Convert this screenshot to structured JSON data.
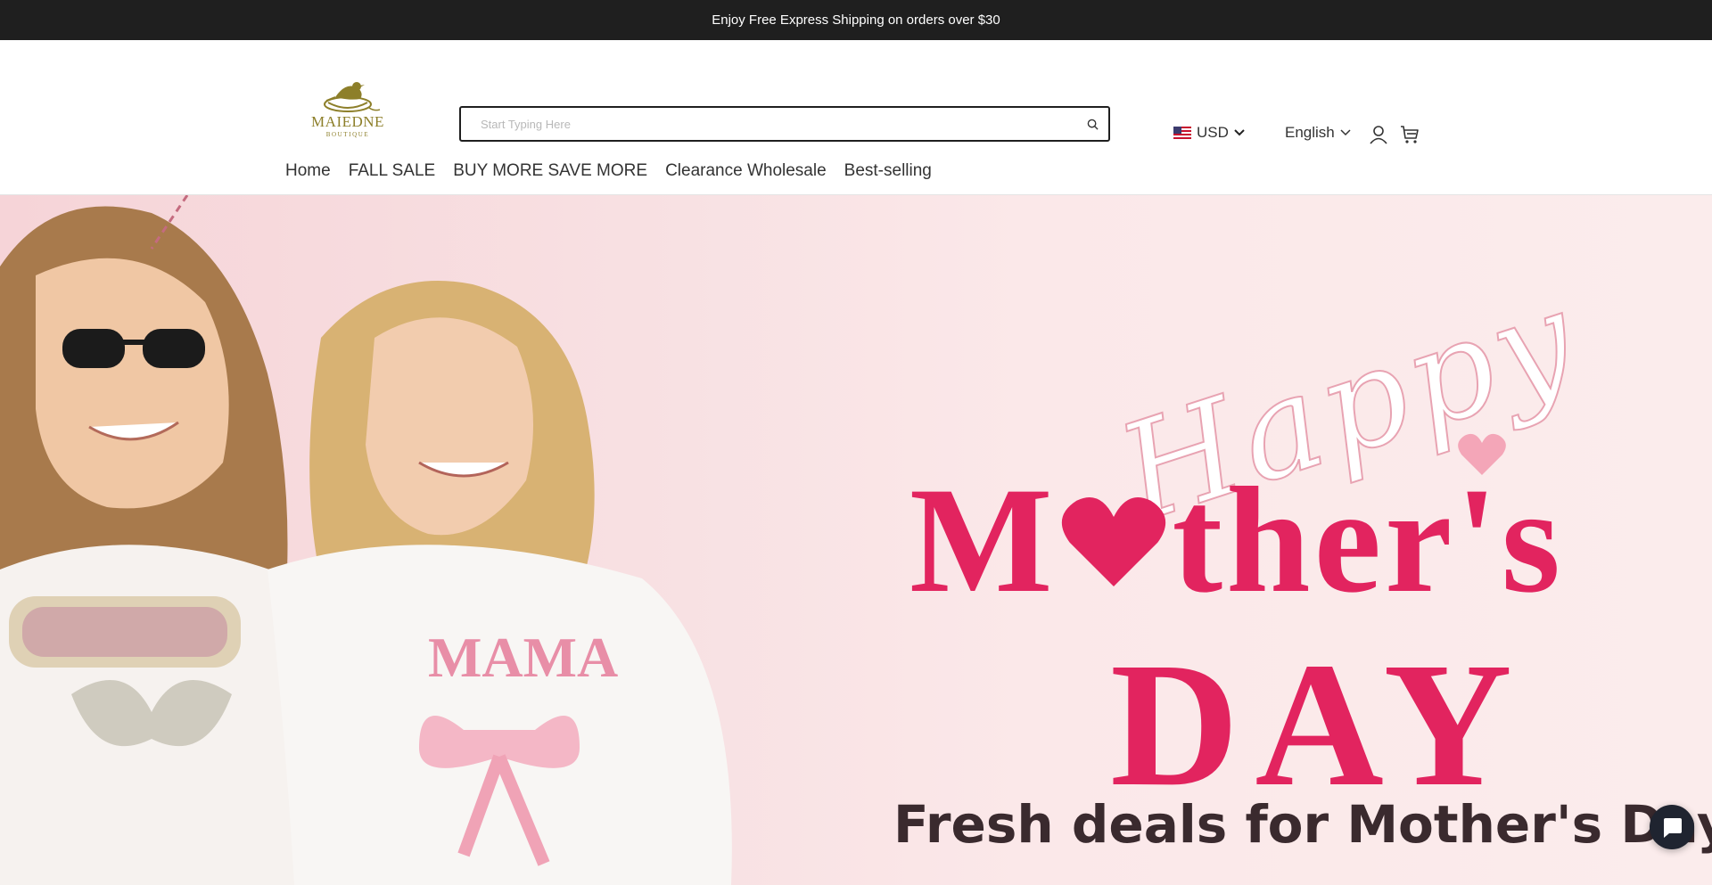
{
  "announcement": {
    "text": "Enjoy Free Express Shipping on orders over $30"
  },
  "logo": {
    "name": "MAIEDNE",
    "tagline": "BOUTIQUE"
  },
  "search": {
    "placeholder": "Start Typing Here",
    "value": ""
  },
  "currency": {
    "label": "USD",
    "flag": "us-flag-icon"
  },
  "language": {
    "label": "English"
  },
  "nav": {
    "items": [
      "Home",
      "FALL SALE",
      "BUY MORE SAVE MORE",
      "Clearance Wholesale",
      "Best-selling"
    ]
  },
  "hero": {
    "script_text": "Happy",
    "headline_part1": "M",
    "headline_part2": "ther's",
    "headline_line2": "DAY",
    "subheadline": "Fresh deals for Mother's Day",
    "shirt_text": "MAMA"
  },
  "colors": {
    "accent": "#e2245f",
    "topbar": "#1f1f1f",
    "logo": "#8d7f2a"
  }
}
